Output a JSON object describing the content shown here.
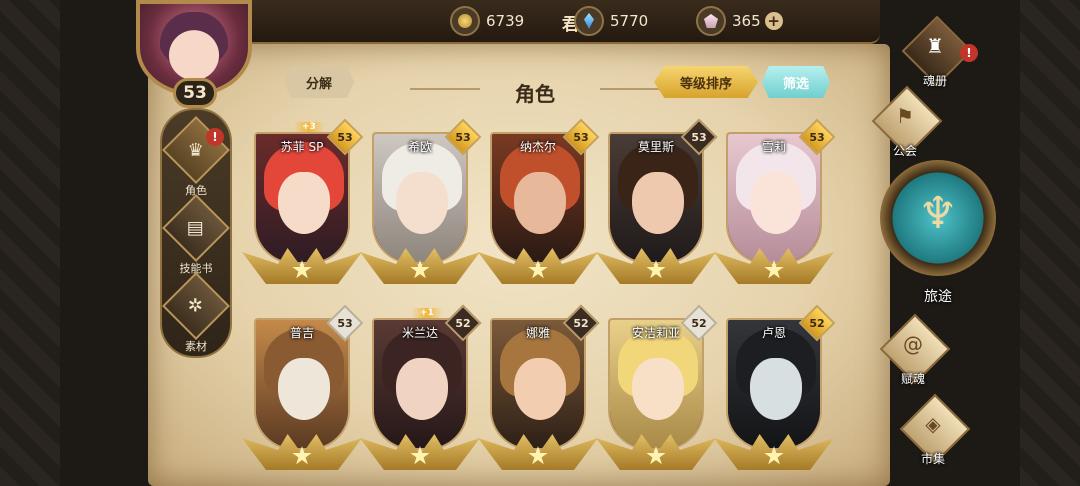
{
  "player": {
    "name": "君君",
    "level": "53"
  },
  "resources": [
    {
      "icon": "gold-coin-icon",
      "value": "6739"
    },
    {
      "icon": "blue-crystal-icon",
      "value": "5770"
    },
    {
      "icon": "pink-gem-icon",
      "value": "365",
      "plus": "+"
    }
  ],
  "header": {
    "title": "角色",
    "decompose_label": "分解",
    "sort_label": "等级排序",
    "filter_label": "筛选"
  },
  "left_menu": [
    {
      "label": "角色",
      "icon": "character-icon",
      "alert": "!"
    },
    {
      "label": "技能书",
      "icon": "skill-book-icon"
    },
    {
      "label": "素材",
      "icon": "material-icon"
    }
  ],
  "right_menu": {
    "soul_book": {
      "label": "魂册",
      "alert": "!"
    },
    "guild": {
      "label": "公会"
    },
    "journey": {
      "label": "旅途"
    },
    "soul_talent": {
      "label": "赋魂"
    },
    "market": {
      "label": "市集"
    }
  },
  "characters": [
    {
      "name": "苏菲 SP",
      "level": "53",
      "badge": "+3",
      "level_style": "gold"
    },
    {
      "name": "希欧",
      "level": "53",
      "level_style": "gold"
    },
    {
      "name": "纳杰尔",
      "level": "53",
      "level_style": "gold"
    },
    {
      "name": "莫里斯",
      "level": "53",
      "level_style": "dark"
    },
    {
      "name": "雪莉",
      "level": "53",
      "level_style": "gold"
    },
    {
      "name": "普吉",
      "level": "53",
      "level_style": "light"
    },
    {
      "name": "米兰达",
      "level": "52",
      "badge": "+1",
      "level_style": "dark"
    },
    {
      "name": "娜雅",
      "level": "52",
      "level_style": "dark"
    },
    {
      "name": "安洁莉亚",
      "level": "52",
      "level_style": "light"
    },
    {
      "name": "卢恩",
      "level": "52",
      "level_style": "gold"
    }
  ],
  "colors": {
    "parchment": "#e6d3ac",
    "gold_button": "#f7d56f",
    "teal_button": "#6fcfcf",
    "alert_red": "#c2352b"
  }
}
